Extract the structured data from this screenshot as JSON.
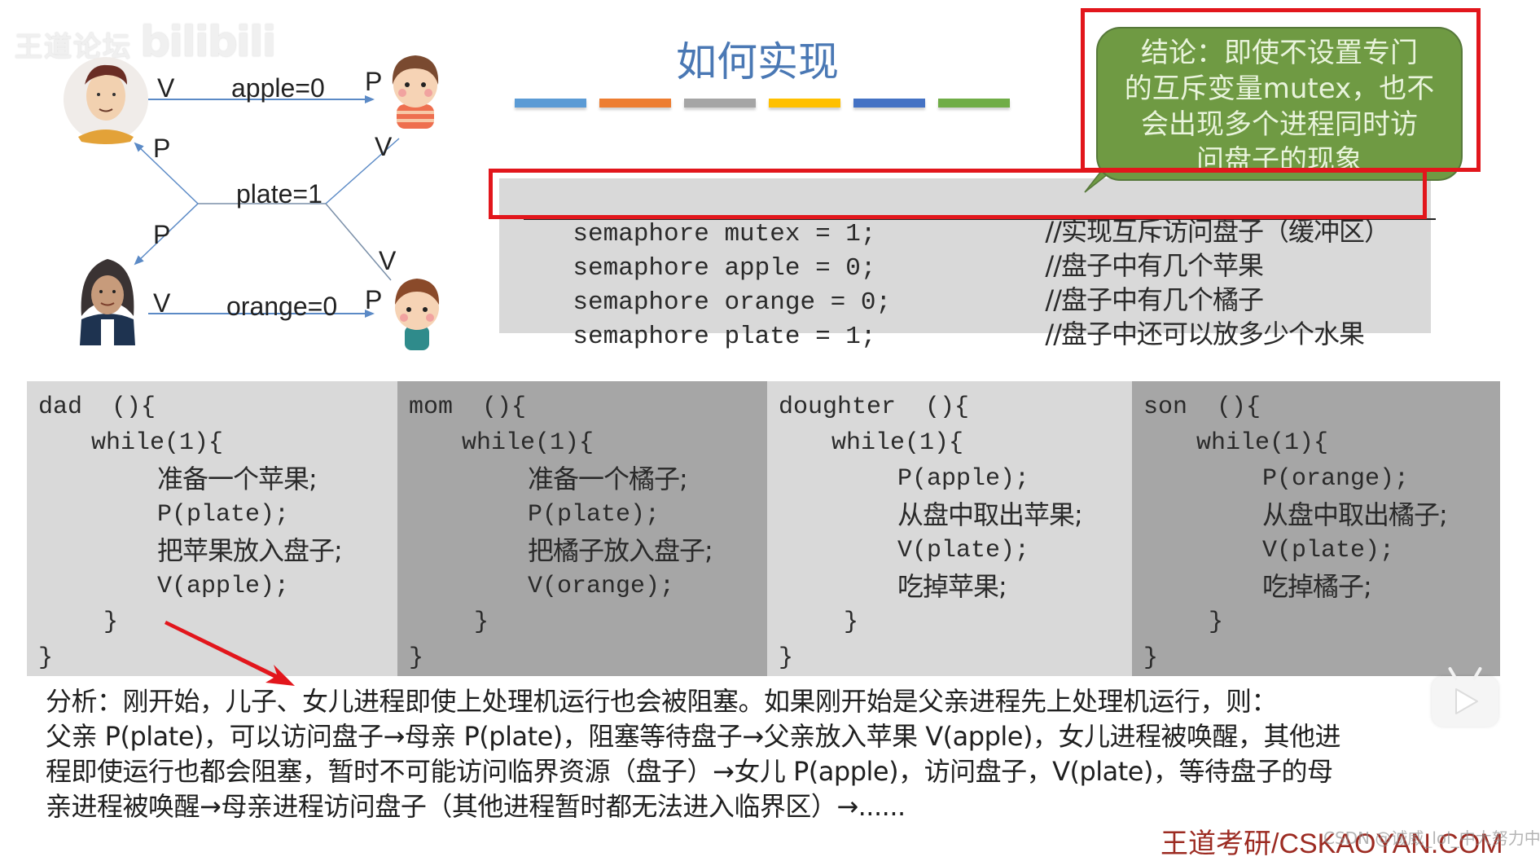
{
  "watermark": {
    "forum": "王道论坛",
    "brand": "bilibili"
  },
  "title": "如何实现",
  "title_bar_colors": [
    "#5b9bd5",
    "#ed7d31",
    "#a5a5a5",
    "#ffc000",
    "#4472c4",
    "#70ad47"
  ],
  "diagram": {
    "people": [
      {
        "name": "dad",
        "role": "father"
      },
      {
        "name": "daughter",
        "role": "daughter"
      },
      {
        "name": "mom",
        "role": "mother"
      },
      {
        "name": "son",
        "role": "son"
      }
    ],
    "semaphores": {
      "apple": "apple=0",
      "plate": "plate=1",
      "orange": "orange=0"
    },
    "op_labels": {
      "dad_apple": "V",
      "daughter_apple": "P",
      "dad_plate": "P",
      "daughter_plate": "V",
      "mom_plate": "P",
      "son_plate": "V",
      "mom_orange": "V",
      "son_orange": "P"
    }
  },
  "callout": {
    "lines": [
      "结论：即使不设置专门",
      "的互斥变量mutex，也不",
      "会出现多个进程同时访",
      "问盘子的现象"
    ]
  },
  "semaphore_decls": [
    {
      "code": "semaphore mutex = 1;",
      "comment": "//实现互斥访问盘子（缓冲区）",
      "struck": true
    },
    {
      "code": "semaphore apple = 0;",
      "comment": "//盘子中有几个苹果",
      "struck": false
    },
    {
      "code": "semaphore orange = 0;",
      "comment": "//盘子中有几个橘子",
      "struck": false
    },
    {
      "code": "semaphore plate = 1;",
      "comment": "//盘子中还可以放多少个水果",
      "struck": false
    }
  ],
  "processes": [
    {
      "header": "dad  (){",
      "loop": "while(1){",
      "body": [
        "准备一个苹果;",
        "P(plate);",
        "把苹果放入盘子;",
        "V(apple);"
      ],
      "close_inner": "}",
      "close_outer": "}"
    },
    {
      "header": "mom  (){",
      "loop": "while(1){",
      "body": [
        "准备一个橘子;",
        "P(plate);",
        "把橘子放入盘子;",
        "V(orange);"
      ],
      "close_inner": "}",
      "close_outer": "}"
    },
    {
      "header": "doughter  (){",
      "loop": "while(1){",
      "body": [
        "P(apple);",
        "从盘中取出苹果;",
        "V(plate);",
        "吃掉苹果;"
      ],
      "close_inner": "}",
      "close_outer": "}"
    },
    {
      "header": "son  (){",
      "loop": "while(1){",
      "body": [
        "P(orange);",
        "从盘中取出橘子;",
        "V(plate);",
        "吃掉橘子;"
      ],
      "close_inner": "}",
      "close_outer": "}"
    }
  ],
  "analysis": {
    "lines": [
      "分析：刚开始，儿子、女儿进程即使上处理机运行也会被阻塞。如果刚开始是父亲进程先上处理机运行，则：",
      "父亲 P(plate)，可以访问盘子→母亲 P(plate)，阻塞等待盘子→父亲放入苹果 V(apple)，女儿进程被唤醒，其他进",
      "程即使运行也都会阻塞，暂时不可能访问临界资源（盘子）→女儿 P(apple)，访问盘子，V(plate)，等待盘子的母",
      "亲进程被唤醒→母亲进程访问盘子（其他进程暂时都无法进入临界区）→......"
    ]
  },
  "footer": "王道考研/CSKAOYAN.COM",
  "csdn_watermark": "CSDN @诚威_lol_中大努力中",
  "colors": {
    "accent_red": "#e2161c",
    "callout_green": "#6f9a43",
    "title_blue": "#4a78b4",
    "panel_light": "#d9d9d9",
    "panel_dark": "#a6a6a6",
    "arrow_blue": "#5b8ac6"
  }
}
